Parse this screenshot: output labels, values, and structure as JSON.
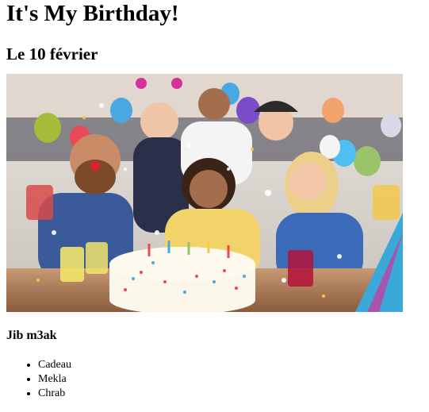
{
  "page": {
    "title": "It's My Birthday!",
    "date": "Le 10 février",
    "photo_alt": "party-photo",
    "section_heading": "Jib m3ak",
    "items": [
      "Cadeau",
      "Mekla",
      "Chrab"
    ]
  },
  "colors": {
    "background": "#ffffff",
    "text": "#000000"
  }
}
